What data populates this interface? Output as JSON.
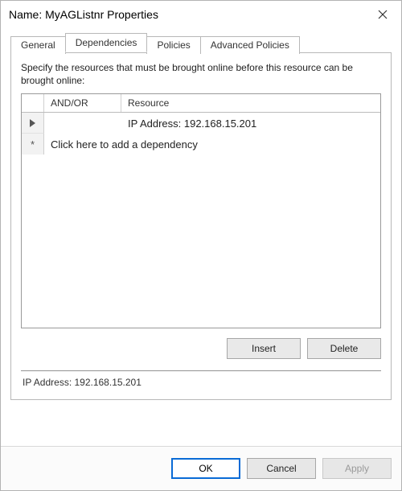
{
  "title": "Name: MyAGListnr Properties",
  "tabs": {
    "general": "General",
    "dependencies": "Dependencies",
    "policies": "Policies",
    "advanced": "Advanced Policies",
    "active": "dependencies"
  },
  "dependencies": {
    "instruction": "Specify the resources that must be brought online before this resource can be brought online:",
    "columns": {
      "andor": "AND/OR",
      "resource": "Resource"
    },
    "rows": [
      {
        "andor": "",
        "resource": "IP Address: 192.168.15.201"
      }
    ],
    "newRowPlaceholder": "Click here to add a dependency",
    "buttons": {
      "insert": "Insert",
      "delete": "Delete"
    },
    "status": "IP Address: 192.168.15.201"
  },
  "dialogButtons": {
    "ok": "OK",
    "cancel": "Cancel",
    "apply": "Apply"
  }
}
